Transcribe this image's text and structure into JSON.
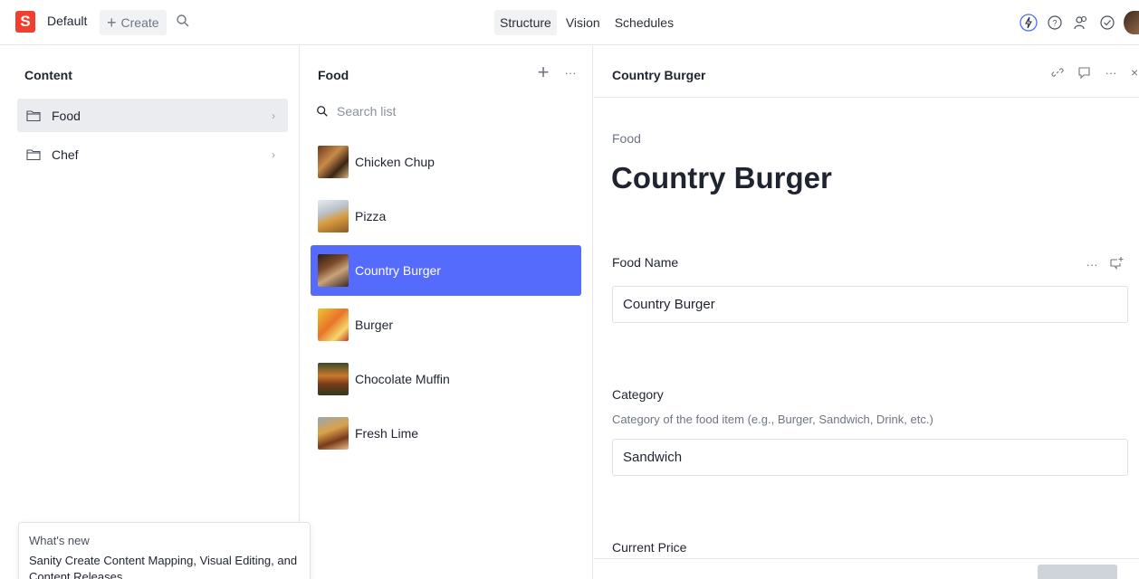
{
  "topbar": {
    "logo_letter": "S",
    "workspace": "Default",
    "create_label": "Create",
    "tabs": [
      {
        "label": "Structure",
        "active": true
      },
      {
        "label": "Vision",
        "active": false
      },
      {
        "label": "Schedules",
        "active": false
      }
    ],
    "icons": [
      "lightning-icon",
      "help-icon",
      "people-icon",
      "check-circle-icon",
      "avatar"
    ]
  },
  "content_pane": {
    "title": "Content",
    "items": [
      {
        "label": "Food",
        "selected": true,
        "icon": "folder-icon"
      },
      {
        "label": "Chef",
        "selected": false,
        "icon": "folder-icon"
      }
    ]
  },
  "whats_new": {
    "title": "What's new",
    "text": "Sanity Create Content Mapping, Visual Editing, and Content Releases"
  },
  "list_pane": {
    "title": "Food",
    "search_placeholder": "Search list",
    "items": [
      {
        "label": "Chicken Chup",
        "selected": false
      },
      {
        "label": "Pizza",
        "selected": false
      },
      {
        "label": "Country Burger",
        "selected": true
      },
      {
        "label": "Burger",
        "selected": false
      },
      {
        "label": "Chocolate Muffin",
        "selected": false
      },
      {
        "label": "Fresh Lime",
        "selected": false
      }
    ]
  },
  "document_pane": {
    "header_title": "Country Burger",
    "doc_type": "Food",
    "doc_title": "Country Burger",
    "fields": {
      "food_name": {
        "label": "Food Name",
        "value": "Country Burger"
      },
      "category": {
        "label": "Category",
        "description": "Category of the food item (e.g., Burger, Sandwich, Drink, etc.)",
        "value": "Sandwich"
      },
      "current_price": {
        "label": "Current Price"
      }
    }
  },
  "colors": {
    "brand": "#f03e2f",
    "selection": "#556bfc"
  }
}
